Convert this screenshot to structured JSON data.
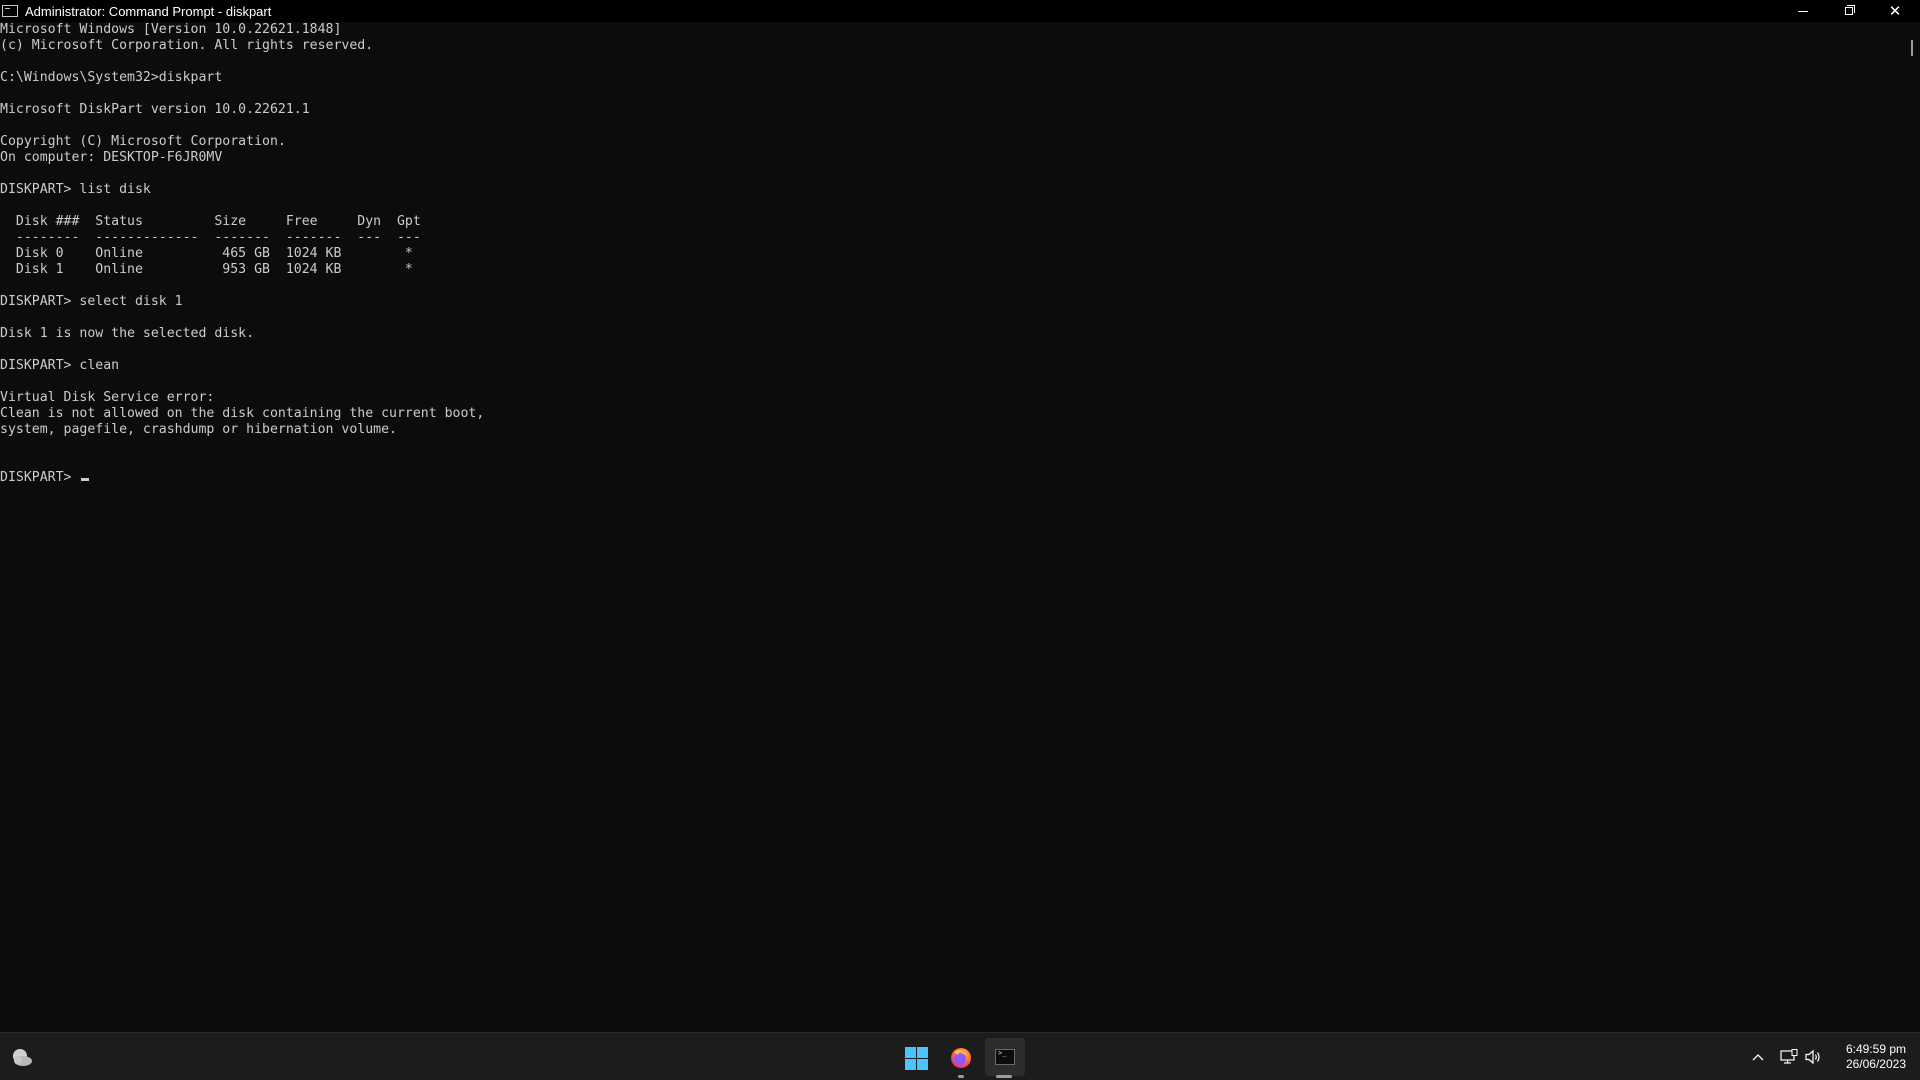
{
  "window": {
    "title": "Administrator: Command Prompt - diskpart"
  },
  "console": {
    "lines": [
      "Microsoft Windows [Version 10.0.22621.1848]",
      "(c) Microsoft Corporation. All rights reserved.",
      "",
      "C:\\Windows\\System32>diskpart",
      "",
      "Microsoft DiskPart version 10.0.22621.1",
      "",
      "Copyright (C) Microsoft Corporation.",
      "On computer: DESKTOP-F6JR0MV",
      "",
      "DISKPART> list disk",
      "",
      "  Disk ###  Status         Size     Free     Dyn  Gpt",
      "  --------  -------------  -------  -------  ---  ---",
      "  Disk 0    Online          465 GB  1024 KB        *",
      "  Disk 1    Online          953 GB  1024 KB        *",
      "",
      "DISKPART> select disk 1",
      "",
      "Disk 1 is now the selected disk.",
      "",
      "DISKPART> clean",
      "",
      "Virtual Disk Service error:",
      "Clean is not allowed on the disk containing the current boot,",
      "system, pagefile, crashdump or hibernation volume.",
      "",
      ""
    ],
    "prompt": "DISKPART> ",
    "input_value": ""
  },
  "taskbar": {
    "icons": {
      "weather": "weather-icon",
      "start": "windows-start-icon",
      "firefox": "firefox-icon",
      "terminal": "command-prompt-icon",
      "chevron": "chevron-up-icon",
      "network": "network-icon",
      "volume": "volume-icon"
    },
    "colors": {
      "start_accent": "#4cc2ff",
      "firefox_orange": "#ff7139",
      "firefox_purple": "#9059ff"
    },
    "clock": {
      "time": "6:49:59 pm",
      "date": "26/06/2023"
    }
  }
}
